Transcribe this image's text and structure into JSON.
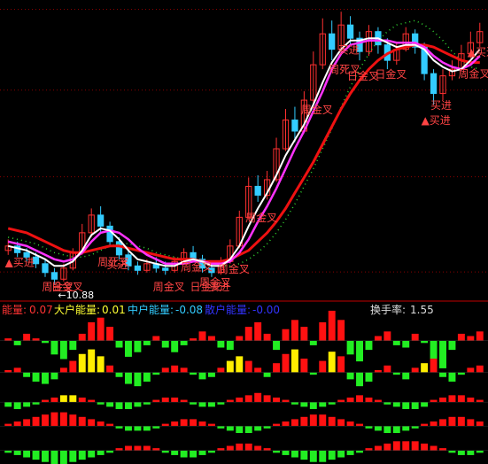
{
  "chart_data": {
    "type": "candlestick",
    "colors": {
      "up": "#ff3030",
      "down": "#33ccff",
      "ma_short": "#ffffff",
      "ma_mid": "#ff33ff",
      "ma_long": "#ee1111",
      "ma_dots": "#33dd33",
      "signal": "#ff4444",
      "bar_up": "#ff1111",
      "bar_down": "#22ee22",
      "bar_yellow": "#ffee00",
      "divider": "#c00000"
    },
    "price_low_label": "10.88",
    "candles": [
      [
        12.4,
        12.6,
        12.9,
        12.2
      ],
      [
        12.6,
        12.3,
        12.8,
        12.1
      ],
      [
        12.3,
        12.1,
        12.5,
        11.9
      ],
      [
        12.1,
        11.8,
        12.3,
        11.6
      ],
      [
        11.8,
        11.4,
        12.0,
        11.2
      ],
      [
        11.4,
        11.1,
        11.6,
        10.88
      ],
      [
        11.1,
        11.6,
        11.8,
        11.0
      ],
      [
        11.6,
        12.3,
        12.5,
        11.5
      ],
      [
        12.3,
        13.2,
        13.6,
        12.2
      ],
      [
        13.2,
        14.0,
        14.3,
        13.0
      ],
      [
        14.0,
        13.5,
        14.4,
        13.2
      ],
      [
        13.5,
        12.8,
        13.7,
        12.6
      ],
      [
        12.8,
        12.2,
        13.0,
        12.0
      ],
      [
        12.2,
        11.7,
        12.4,
        11.5
      ],
      [
        11.7,
        11.5,
        11.9,
        11.3
      ],
      [
        11.5,
        11.8,
        12.0,
        11.4
      ],
      [
        11.8,
        11.6,
        12.1,
        11.4
      ],
      [
        11.6,
        11.5,
        11.9,
        11.3
      ],
      [
        11.5,
        11.9,
        12.1,
        11.4
      ],
      [
        11.9,
        12.3,
        12.5,
        11.8
      ],
      [
        12.3,
        12.0,
        12.6,
        11.9
      ],
      [
        12.0,
        11.6,
        12.2,
        11.4
      ],
      [
        11.6,
        11.4,
        11.8,
        11.2
      ],
      [
        11.4,
        11.9,
        12.1,
        11.3
      ],
      [
        11.9,
        12.6,
        12.9,
        11.8
      ],
      [
        12.6,
        13.9,
        14.2,
        12.5
      ],
      [
        13.9,
        15.3,
        15.7,
        13.8
      ],
      [
        15.3,
        14.9,
        15.8,
        14.6
      ],
      [
        14.9,
        15.6,
        16.0,
        14.7
      ],
      [
        15.6,
        17.0,
        17.5,
        15.5
      ],
      [
        17.0,
        18.3,
        18.8,
        16.9
      ],
      [
        18.3,
        17.8,
        18.9,
        17.3
      ],
      [
        17.8,
        19.2,
        19.6,
        17.7
      ],
      [
        19.2,
        20.8,
        21.4,
        19.0
      ],
      [
        20.8,
        22.2,
        22.9,
        20.6
      ],
      [
        22.2,
        21.5,
        22.8,
        21.0
      ],
      [
        21.5,
        22.6,
        23.2,
        21.3
      ],
      [
        22.6,
        22.0,
        23.0,
        21.7
      ],
      [
        22.0,
        21.4,
        22.3,
        21.0
      ],
      [
        21.4,
        22.3,
        22.6,
        21.2
      ],
      [
        22.3,
        21.7,
        22.5,
        21.3
      ],
      [
        21.7,
        21.0,
        22.0,
        20.6
      ],
      [
        21.0,
        21.5,
        21.8,
        20.8
      ],
      [
        21.5,
        22.2,
        22.5,
        21.4
      ],
      [
        22.2,
        21.6,
        22.4,
        21.3
      ],
      [
        21.6,
        20.4,
        21.8,
        20.1
      ],
      [
        20.4,
        19.5,
        20.6,
        19.0
      ],
      [
        19.5,
        20.3,
        20.6,
        19.2
      ],
      [
        20.3,
        20.6,
        21.0,
        20.1
      ],
      [
        20.6,
        21.3,
        21.7,
        20.5
      ],
      [
        21.3,
        21.8,
        22.3,
        21.1
      ],
      [
        21.8,
        22.3,
        22.7,
        21.6
      ]
    ],
    "ma_short": [
      12.6,
      12.5,
      12.4,
      12.2,
      12.0,
      11.7,
      11.7,
      11.9,
      12.4,
      13.1,
      13.4,
      13.3,
      12.9,
      12.4,
      12.0,
      11.9,
      11.8,
      11.7,
      11.7,
      11.9,
      12.0,
      11.9,
      11.7,
      11.7,
      12.0,
      12.6,
      13.5,
      14.3,
      15.0,
      15.8,
      16.7,
      17.4,
      18.1,
      19.0,
      20.0,
      20.9,
      21.5,
      21.9,
      21.9,
      22.0,
      22.0,
      21.8,
      21.6,
      21.7,
      21.7,
      21.5,
      21.0,
      20.7,
      20.5,
      20.6,
      21.0,
      21.5
    ],
    "ma_mid": [
      12.8,
      12.7,
      12.6,
      12.4,
      12.2,
      12.0,
      11.9,
      12.0,
      12.3,
      12.8,
      13.2,
      13.3,
      13.2,
      12.9,
      12.5,
      12.2,
      12.0,
      11.8,
      11.8,
      11.8,
      11.9,
      11.9,
      11.8,
      11.8,
      11.9,
      12.3,
      12.9,
      13.7,
      14.4,
      15.2,
      16.1,
      17.0,
      17.8,
      18.7,
      19.6,
      20.6,
      21.3,
      21.7,
      21.8,
      21.9,
      21.9,
      21.9,
      21.8,
      21.8,
      21.8,
      21.6,
      21.2,
      20.9,
      20.7,
      20.6,
      20.8,
      21.2
    ],
    "ma_long": [
      13.4,
      13.3,
      13.2,
      13.0,
      12.8,
      12.6,
      12.4,
      12.3,
      12.3,
      12.4,
      12.5,
      12.6,
      12.6,
      12.5,
      12.4,
      12.3,
      12.2,
      12.1,
      12.0,
      12.0,
      12.0,
      11.9,
      11.9,
      11.9,
      12.0,
      12.2,
      12.4,
      12.8,
      13.2,
      13.7,
      14.3,
      15.0,
      15.7,
      16.4,
      17.2,
      18.0,
      18.8,
      19.5,
      20.1,
      20.6,
      21.0,
      21.3,
      21.5,
      21.6,
      21.7,
      21.7,
      21.6,
      21.4,
      21.2,
      21.0,
      20.9,
      20.9
    ],
    "ma_dots": [
      13.0,
      12.9,
      12.8,
      12.7,
      12.5,
      12.3,
      12.2,
      12.1,
      12.1,
      12.2,
      12.4,
      12.6,
      12.7,
      12.7,
      12.6,
      12.5,
      12.3,
      12.2,
      12.1,
      12.0,
      11.9,
      11.8,
      11.7,
      11.7,
      11.7,
      11.8,
      12.0,
      12.3,
      12.7,
      13.2,
      13.8,
      14.5,
      15.3,
      16.1,
      17.0,
      17.9,
      18.9,
      19.8,
      20.6,
      21.3,
      21.9,
      22.3,
      22.6,
      22.7,
      22.8,
      22.6,
      22.3,
      21.9,
      21.4,
      21.0,
      20.7,
      20.6
    ],
    "signals": [
      {
        "i": 1,
        "text": "▲买进"
      },
      {
        "i": 5,
        "text": "周金叉"
      },
      {
        "i": 6,
        "text": "日金叉"
      },
      {
        "i": 11,
        "text": "周死叉"
      },
      {
        "i": 12,
        "text": "买进"
      },
      {
        "i": 17,
        "text": "周金叉"
      },
      {
        "i": 20,
        "text": "周金叉"
      },
      {
        "i": 21,
        "text": "日金叉"
      },
      {
        "i": 22,
        "text": "周金叉"
      },
      {
        "i": 23,
        "text": "买进"
      },
      {
        "i": 24,
        "text": "周金叉"
      },
      {
        "i": 27,
        "text": "周金叉"
      },
      {
        "i": 33,
        "text": "周金叉"
      },
      {
        "i": 36,
        "text": "周死叉"
      },
      {
        "i": 37,
        "text": "买进"
      },
      {
        "i": 38,
        "text": "日金叉"
      },
      {
        "i": 41,
        "text": "日金叉"
      },
      {
        "i": 46,
        "text": "▲买进"
      },
      {
        "i": 47,
        "text": "买进"
      },
      {
        "i": 50,
        "text": "周金叉"
      },
      {
        "i": 51,
        "text": "▲买进"
      }
    ],
    "indicator": {
      "labels": [
        {
          "name": "能量:",
          "value": "0.07",
          "color": "#ff3333"
        },
        {
          "name": "大户能量:",
          "value": "0.01",
          "color": "#ffff33"
        },
        {
          "name": "中户能量:",
          "value": "-0.08",
          "color": "#33ccff"
        },
        {
          "name": "散户能量:",
          "value": "-0.00",
          "color": "#3333ff"
        }
      ],
      "turnover": {
        "name": "换手率:",
        "value": "1.55"
      },
      "rows": [
        {
          "baseline_frac": 0.142,
          "values": [
            0.1,
            -0.2,
            0.3,
            0.1,
            -0.1,
            -0.6,
            -0.8,
            -0.4,
            0.3,
            0.8,
            1.0,
            0.6,
            -0.3,
            -0.7,
            -0.5,
            -0.2,
            0.2,
            -0.3,
            -0.5,
            -0.2,
            0.1,
            0.4,
            0.2,
            -0.3,
            -0.4,
            0.2,
            0.6,
            0.8,
            0.3,
            -0.4,
            0.5,
            0.9,
            0.6,
            -0.2,
            0.8,
            1.3,
            0.9,
            -0.6,
            -0.9,
            -0.4,
            0.2,
            0.4,
            -0.2,
            -0.3,
            0.3,
            -0.1,
            -0.8,
            -1.2,
            -0.4,
            0.3,
            0.2,
            0.4
          ]
        },
        {
          "baseline_frac": 0.366,
          "values": [
            0.1,
            0.2,
            -0.2,
            -0.4,
            -0.5,
            -0.3,
            0.2,
            0.5,
            0.8,
            1.0,
            0.7,
            0.3,
            -0.2,
            -0.5,
            -0.6,
            -0.4,
            -0.1,
            0.2,
            0.3,
            0.2,
            -0.1,
            -0.3,
            -0.2,
            0.2,
            0.5,
            0.7,
            0.5,
            0.2,
            -0.2,
            0.4,
            0.8,
            1.0,
            0.6,
            -0.1,
            0.5,
            0.9,
            0.7,
            -0.3,
            -0.6,
            -0.4,
            0.1,
            0.3,
            -0.1,
            -0.3,
            0.2,
            0.4,
            0.6,
            -0.2,
            -0.4,
            -0.1,
            0.2,
            0.3
          ],
          "yellow": [
            8,
            9,
            10,
            24,
            25,
            31,
            35,
            45
          ]
        },
        {
          "baseline_frac": 0.576,
          "values": [
            -0.2,
            -0.3,
            -0.2,
            -0.1,
            0.1,
            0.2,
            0.3,
            0.3,
            0.2,
            0.1,
            -0.1,
            -0.2,
            -0.3,
            -0.3,
            -0.2,
            -0.1,
            0.1,
            0.2,
            0.2,
            0.1,
            -0.1,
            -0.2,
            -0.2,
            -0.1,
            0.1,
            0.2,
            0.3,
            0.4,
            0.3,
            0.2,
            0.1,
            -0.1,
            -0.2,
            -0.3,
            -0.2,
            -0.1,
            0.1,
            0.2,
            0.3,
            0.2,
            0.1,
            -0.1,
            -0.2,
            -0.3,
            -0.3,
            -0.2,
            0.1,
            0.2,
            0.3,
            0.3,
            0.2,
            0.1
          ],
          "yellow": [
            6,
            7
          ]
        },
        {
          "baseline_frac": 0.745,
          "values": [
            0.1,
            0.2,
            0.3,
            0.4,
            0.5,
            0.6,
            0.6,
            0.5,
            0.4,
            0.3,
            0.2,
            0.1,
            -0.1,
            -0.2,
            -0.2,
            -0.2,
            -0.1,
            0.1,
            0.2,
            0.3,
            0.3,
            0.2,
            0.1,
            -0.1,
            -0.2,
            -0.3,
            -0.3,
            -0.2,
            -0.1,
            0.1,
            0.2,
            0.3,
            0.4,
            0.5,
            0.5,
            0.4,
            0.3,
            0.2,
            0.1,
            -0.1,
            -0.2,
            -0.3,
            -0.3,
            -0.2,
            -0.1,
            0.1,
            0.2,
            0.3,
            0.4,
            0.4,
            0.3,
            0.2
          ]
        },
        {
          "baseline_frac": 0.917,
          "values": [
            -0.1,
            -0.2,
            -0.3,
            -0.4,
            -0.5,
            -0.6,
            -0.6,
            -0.5,
            -0.4,
            -0.3,
            -0.2,
            -0.1,
            0.1,
            0.2,
            0.2,
            0.2,
            0.1,
            -0.1,
            -0.2,
            -0.3,
            -0.3,
            -0.2,
            -0.1,
            0.1,
            0.2,
            0.3,
            0.3,
            0.2,
            0.1,
            -0.1,
            -0.2,
            -0.3,
            -0.4,
            -0.5,
            -0.5,
            -0.4,
            -0.3,
            -0.2,
            -0.1,
            0.1,
            0.2,
            0.3,
            0.4,
            0.4,
            0.4,
            0.3,
            0.2,
            0.1,
            -0.1,
            -0.2,
            -0.2,
            -0.1
          ]
        }
      ]
    }
  }
}
